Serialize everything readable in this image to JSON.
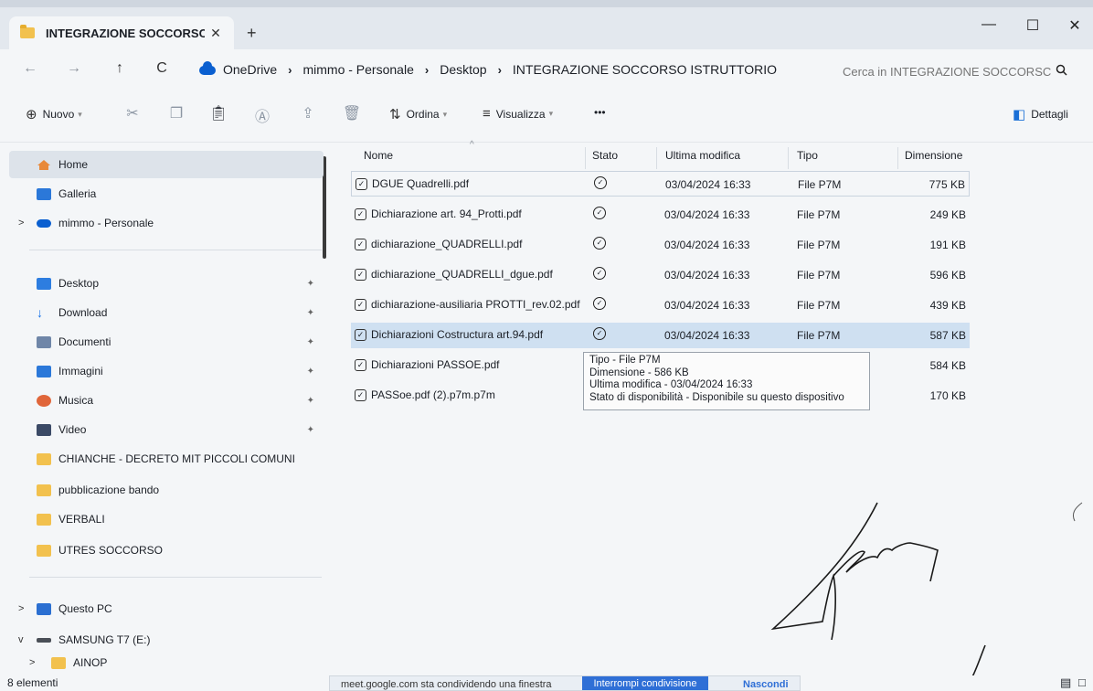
{
  "window": {
    "tab_title": "INTEGRAZIONE SOCCORSO IS",
    "tab_close": "✕",
    "new_tab": "+",
    "minimize": "—",
    "maximize": "☐",
    "close": "✕"
  },
  "address": {
    "back": "←",
    "forward": "→",
    "up": "↑",
    "refresh": "C",
    "breadcrumbs": [
      "OneDrive",
      "mimmo - Personale",
      "Desktop",
      "INTEGRAZIONE SOCCORSO ISTRUTTORIO"
    ],
    "separator": "›",
    "search_placeholder": "Cerca in INTEGRAZIONE SOCCORSC"
  },
  "toolbar": {
    "new_label": "Nuovo",
    "sort_label": "Ordina",
    "view_label": "Visualizza",
    "more": "•••",
    "details_label": "Dettagli"
  },
  "sidebar": {
    "home": "Home",
    "gallery": "Galleria",
    "cloud": "mimmo - Personale",
    "quick": [
      {
        "label": "Desktop",
        "color": "#2d7de0"
      },
      {
        "label": "Download",
        "color": "#1a73e8"
      },
      {
        "label": "Documenti",
        "color": "#6f86a8"
      },
      {
        "label": "Immagini",
        "color": "#2b78d9"
      },
      {
        "label": "Musica",
        "color": "#e0663a"
      },
      {
        "label": "Video",
        "color": "#3b4a66"
      }
    ],
    "folders": [
      "CHIANCHE - DECRETO MIT PICCOLI COMUNI",
      "pubblicazione bando",
      "VERBALI",
      "UTRES SOCCORSO"
    ],
    "this_pc": "Questo PC",
    "drive": "SAMSUNG T7 (E:)",
    "subfolder": "AINOP",
    "chevron_right": ">",
    "chevron_down": "v",
    "pin": "✦"
  },
  "columns": {
    "name": "Nome",
    "status": "Stato",
    "modified": "Ultima modifica",
    "type": "Tipo",
    "size": "Dimensione"
  },
  "files": [
    {
      "name": "DGUE Quadrelli.pdf",
      "status": "✓",
      "modified": "03/04/2024 16:33",
      "type": "File P7M",
      "size": "775 KB"
    },
    {
      "name": "Dichiarazione art. 94_Protti.pdf",
      "status": "✓",
      "modified": "03/04/2024 16:33",
      "type": "File P7M",
      "size": "249 KB"
    },
    {
      "name": "dichiarazione_QUADRELLI.pdf",
      "status": "✓",
      "modified": "03/04/2024 16:33",
      "type": "File P7M",
      "size": "191 KB"
    },
    {
      "name": "dichiarazione_QUADRELLI_dgue.pdf",
      "status": "✓",
      "modified": "03/04/2024 16:33",
      "type": "File P7M",
      "size": "596 KB"
    },
    {
      "name": "dichiarazione-ausiliaria PROTTI_rev.02.pdf",
      "status": "✓",
      "modified": "03/04/2024 16:33",
      "type": "File P7M",
      "size": "439 KB"
    },
    {
      "name": "Dichiarazioni Costructura art.94.pdf",
      "status": "✓",
      "modified": "03/04/2024 16:33",
      "type": "File P7M",
      "size": "587 KB"
    },
    {
      "name": "Dichiarazioni PASSOE.pdf",
      "status": "",
      "modified": "",
      "type": "",
      "size": "584 KB"
    },
    {
      "name": "PASSoe.pdf (2).p7m.p7m",
      "status": "",
      "modified": "",
      "type": "",
      "size": "170 KB"
    }
  ],
  "tooltip": {
    "line1": "Tipo - File P7M",
    "line2": "Dimensione - 586 KB",
    "line3": "Ultima modifica - 03/04/2024 16:33",
    "line4": "Stato di disponibilità - Disponibile su questo dispositivo"
  },
  "status": {
    "count": "8 elementi"
  },
  "share_bar": {
    "message": "meet.google.com sta condividendo una finestra",
    "stop": "Interrompi condivisione",
    "hide": "Nascondi"
  }
}
